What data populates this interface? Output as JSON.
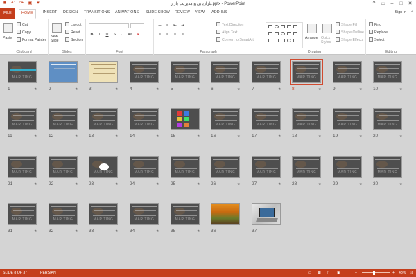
{
  "titlebar": {
    "title": "بازاریابی و مدیریت بازار.pptx - PowerPoint",
    "qat_icons": [
      "save-icon",
      "undo-icon",
      "redo-icon",
      "start-slideshow-icon",
      "customize-icon"
    ],
    "window_icons": [
      "help-icon",
      "restore-ribbon-icon",
      "minimize-icon",
      "maximize-icon",
      "close-icon"
    ]
  },
  "tabs": {
    "file": "FILE",
    "items": [
      "HOME",
      "INSERT",
      "DESIGN",
      "TRANSITIONS",
      "ANIMATIONS",
      "SLIDE SHOW",
      "REVIEW",
      "VIEW",
      "ADD-INS"
    ],
    "active": "HOME",
    "signin": "Sign in"
  },
  "ribbon": {
    "clipboard": {
      "label": "Clipboard",
      "paste": "Paste",
      "cut": "Cut",
      "copy": "Copy",
      "format_painter": "Format Painter"
    },
    "slides": {
      "label": "Slides",
      "new_slide": "New Slide",
      "layout": "Layout",
      "reset": "Reset",
      "section": "Section"
    },
    "font": {
      "label": "Font"
    },
    "paragraph": {
      "label": "Paragraph",
      "text_direction": "Text Direction",
      "align_text": "Align Text",
      "convert_smartart": "Convert to SmartArt"
    },
    "drawing": {
      "label": "Drawing",
      "arrange": "Arrange",
      "quick_styles": "Quick Styles",
      "shape_fill": "Shape Fill",
      "shape_outline": "Shape Outline",
      "shape_effects": "Shape Effects"
    },
    "editing": {
      "label": "Editing",
      "find": "Find",
      "replace": "Replace",
      "select": "Select"
    }
  },
  "slides": [
    {
      "num": "1",
      "style": "title"
    },
    {
      "num": "2",
      "style": "blue"
    },
    {
      "num": "3",
      "style": "cream"
    },
    {
      "num": "4",
      "style": "dark"
    },
    {
      "num": "5",
      "style": "dark"
    },
    {
      "num": "6",
      "style": "dark"
    },
    {
      "num": "7",
      "style": "dark"
    },
    {
      "num": "8",
      "style": "dark",
      "selected": true
    },
    {
      "num": "9",
      "style": "dark"
    },
    {
      "num": "10",
      "style": "dark"
    },
    {
      "num": "11",
      "style": "dark"
    },
    {
      "num": "12",
      "style": "dark"
    },
    {
      "num": "13",
      "style": "dark"
    },
    {
      "num": "14",
      "style": "dark"
    },
    {
      "num": "15",
      "style": "colorful"
    },
    {
      "num": "16",
      "style": "dark"
    },
    {
      "num": "17",
      "style": "dark"
    },
    {
      "num": "18",
      "style": "dark"
    },
    {
      "num": "19",
      "style": "dark"
    },
    {
      "num": "20",
      "style": "dark"
    },
    {
      "num": "21",
      "style": "dark"
    },
    {
      "num": "22",
      "style": "dark"
    },
    {
      "num": "23",
      "style": "circle"
    },
    {
      "num": "24",
      "style": "dark"
    },
    {
      "num": "25",
      "style": "dark"
    },
    {
      "num": "26",
      "style": "dark"
    },
    {
      "num": "27",
      "style": "dark"
    },
    {
      "num": "28",
      "style": "dark"
    },
    {
      "num": "29",
      "style": "dark"
    },
    {
      "num": "30",
      "style": "dark"
    },
    {
      "num": "31",
      "style": "dark"
    },
    {
      "num": "32",
      "style": "dark"
    },
    {
      "num": "33",
      "style": "dark"
    },
    {
      "num": "34",
      "style": "dark"
    },
    {
      "num": "35",
      "style": "dark"
    },
    {
      "num": "36",
      "style": "autumn"
    },
    {
      "num": "37",
      "style": "laptop"
    }
  ],
  "thumb_watermark": "MAR  TING",
  "status": {
    "slide": "SLIDE 8 OF 37",
    "language": "PERSIAN",
    "zoom": "48%",
    "zoom_level": 48,
    "icons": [
      "normal-view-icon",
      "slide-sorter-icon",
      "reading-view-icon",
      "slideshow-icon",
      "fit-slide-icon"
    ]
  },
  "colors": {
    "accent": "#c43e1c",
    "selection": "#d04a2f",
    "sorter_bg": "#d4d4d4"
  }
}
